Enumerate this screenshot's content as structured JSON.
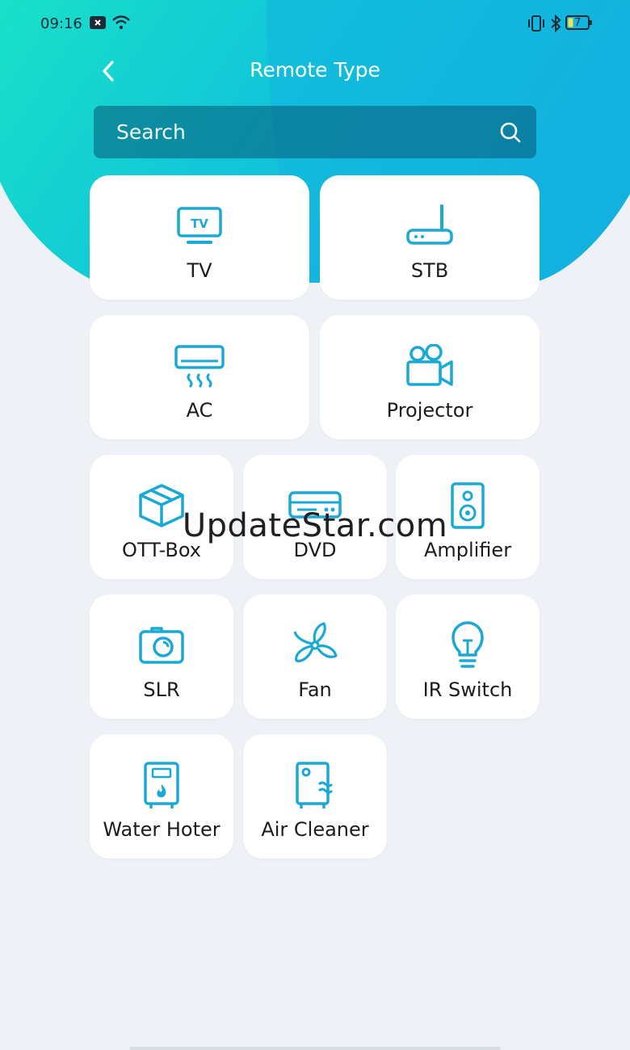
{
  "status_bar": {
    "time": "09:16",
    "battery": "7"
  },
  "header": {
    "title": "Remote Type"
  },
  "search": {
    "placeholder": "Search"
  },
  "colors": {
    "accent": "#19b6d8",
    "icon": "#1aa9d4",
    "wave_light": "#14d8c8",
    "wave_dark": "#12b2dc"
  },
  "devices": [
    {
      "label": "TV",
      "icon": "tv-icon"
    },
    {
      "label": "STB",
      "icon": "router-icon"
    },
    {
      "label": "AC",
      "icon": "air-conditioner-icon"
    },
    {
      "label": "Projector",
      "icon": "video-camera-icon"
    },
    {
      "label": "OTT-Box",
      "icon": "box-icon"
    },
    {
      "label": "DVD",
      "icon": "dvd-player-icon"
    },
    {
      "label": "Amplifier",
      "icon": "speaker-icon"
    },
    {
      "label": "SLR",
      "icon": "camera-icon"
    },
    {
      "label": "Fan",
      "icon": "fan-icon"
    },
    {
      "label": "IR Switch",
      "icon": "lightbulb-icon"
    },
    {
      "label": "Water Hoter",
      "icon": "water-heater-icon"
    },
    {
      "label": "Air Cleaner",
      "icon": "air-purifier-icon"
    }
  ],
  "watermark": "UpdateStar.com"
}
